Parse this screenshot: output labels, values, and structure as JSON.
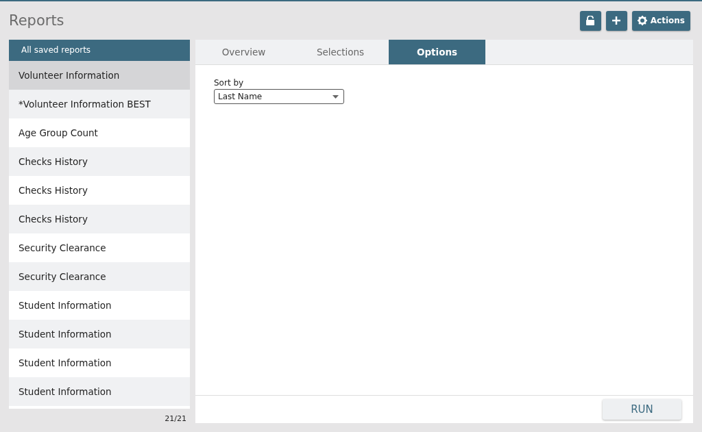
{
  "page": {
    "title": "Reports"
  },
  "toolbar": [
    {
      "kind": "lock"
    },
    {
      "kind": "add"
    },
    {
      "kind": "actions",
      "label": "Actions"
    }
  ],
  "sidebar": {
    "header": "All saved reports",
    "count": "21/21",
    "items": [
      {
        "label": "Volunteer Information",
        "selected": true
      },
      {
        "label": "*Volunteer Information BEST",
        "selected": false
      },
      {
        "label": "Age Group Count",
        "selected": false
      },
      {
        "label": "Checks History",
        "selected": false
      },
      {
        "label": "Checks History",
        "selected": false
      },
      {
        "label": "Checks History",
        "selected": false
      },
      {
        "label": "Security Clearance",
        "selected": false
      },
      {
        "label": "Security Clearance",
        "selected": false
      },
      {
        "label": "Student Information",
        "selected": false
      },
      {
        "label": "Student Information",
        "selected": false
      },
      {
        "label": "Student Information",
        "selected": false
      },
      {
        "label": "Student Information",
        "selected": false
      }
    ]
  },
  "tabs": [
    {
      "label": "Overview",
      "selected": false
    },
    {
      "label": "Selections",
      "selected": false
    },
    {
      "label": "Options",
      "selected": true
    }
  ],
  "options": {
    "sort_label": "Sort by",
    "sort_value": "Last Name"
  },
  "run_button": "RUN"
}
